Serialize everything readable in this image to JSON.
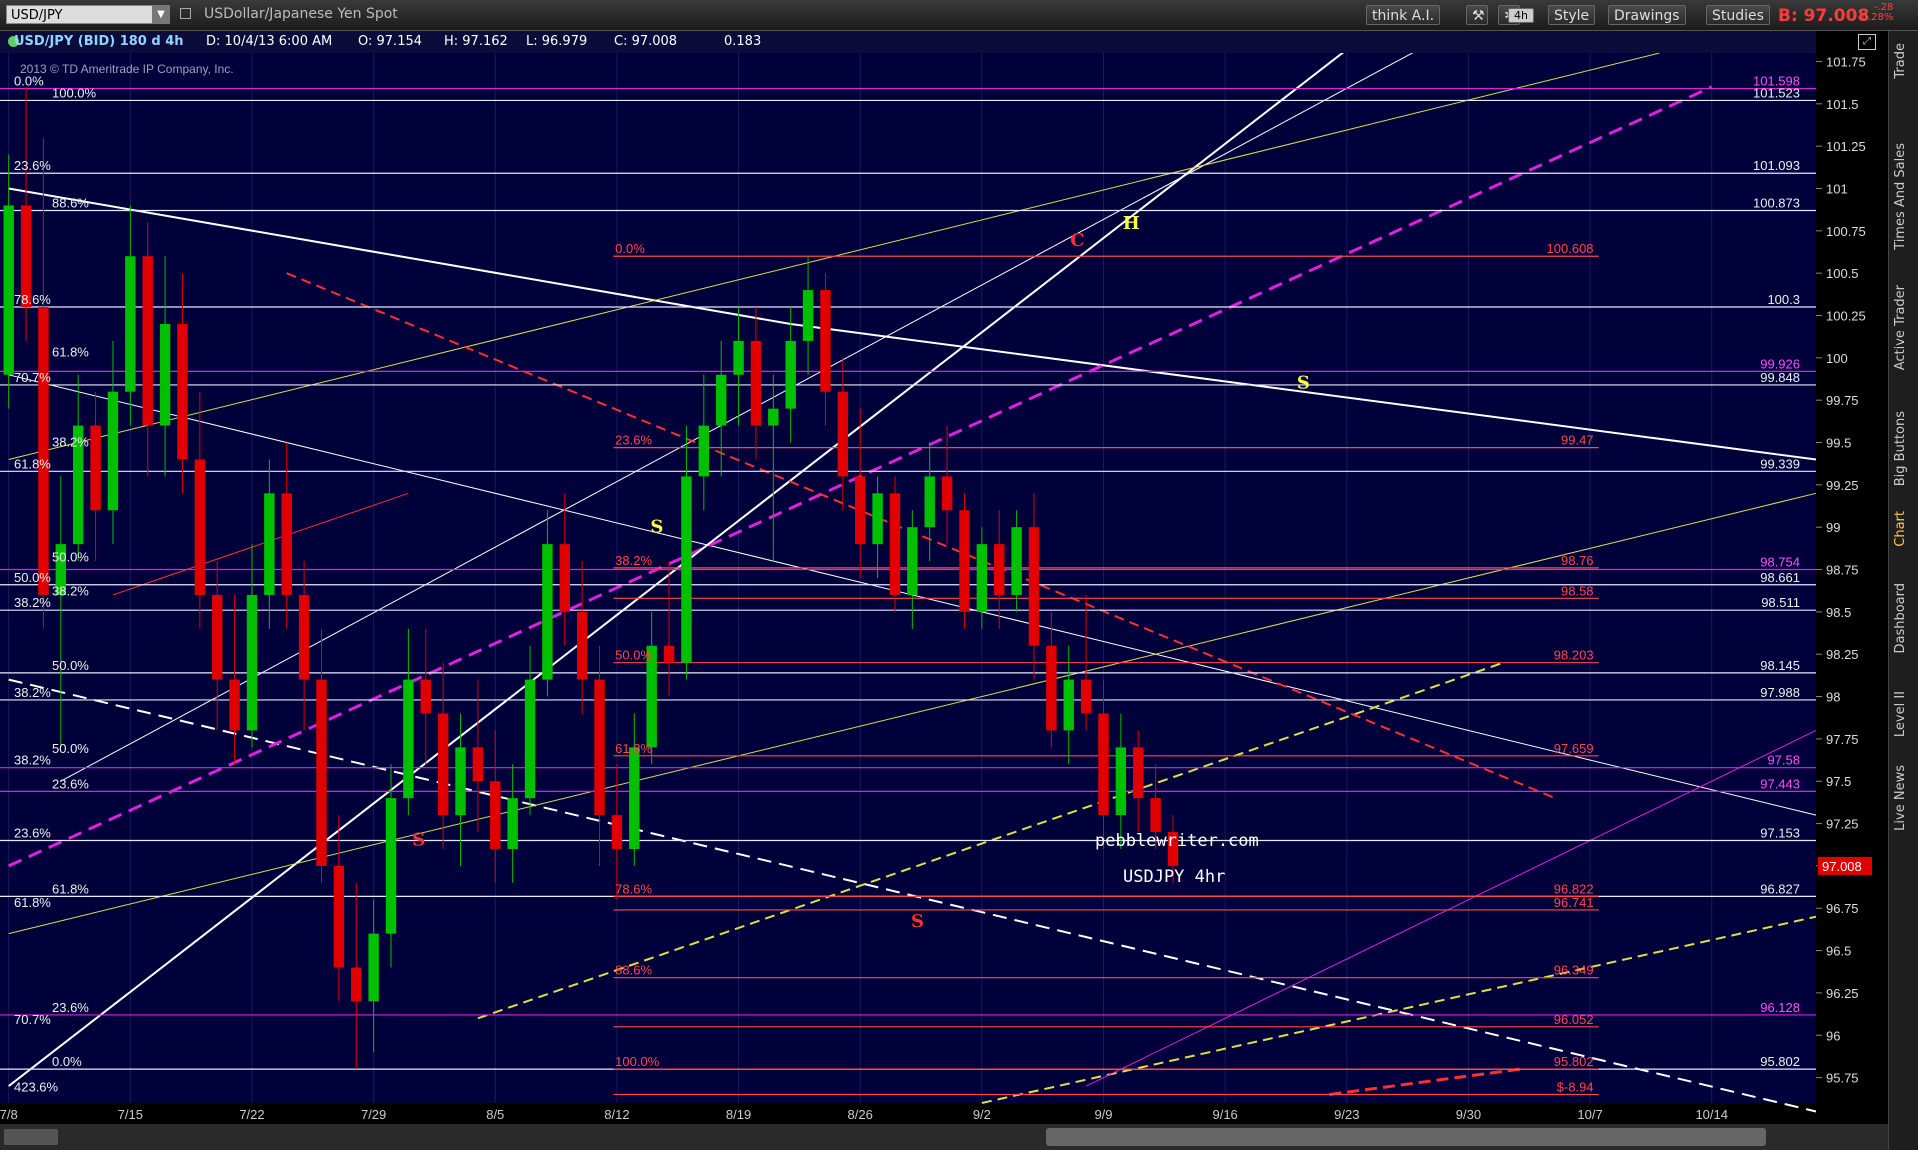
{
  "toolbar": {
    "symbol": "USD/JPY",
    "description": "USDollar/Japanese Yen Spot",
    "think_label": "think A.I.",
    "period_label": "4h",
    "style_label": "Style",
    "drawings_label": "Drawings",
    "studies_label": "Studies",
    "last_price": "B: 97.008",
    "change_1": "-.28",
    "change_2": "-0.28%"
  },
  "infobar": {
    "title": "USD/JPY (BID) 180 d 4h",
    "date": "D: 10/4/13 6:00 AM",
    "open": "O: 97.154",
    "high": "H: 97.162",
    "low": "L: 96.979",
    "close": "C: 97.008",
    "change": "0.183"
  },
  "side_tabs": [
    "Trade",
    "Times And Sales",
    "Active Trader",
    "Big Buttons",
    "Chart",
    "Dashboard",
    "Level II",
    "Live News"
  ],
  "copyright": "2013 © TD Ameritrade IP Company, Inc.",
  "watermark": "pebblewriter.com",
  "chart_title": "USDJPY 4hr",
  "colors": {
    "background": "#00003a",
    "up_candle": "#00c000",
    "down_candle": "#e00000",
    "white_line": "#ffffff",
    "magenta": "#e020e0",
    "yellow": "#e0e040",
    "red": "#ff3030",
    "pink": "#ff3070",
    "price_axis_text": "#dddddd"
  },
  "chart_data": {
    "type": "candlestick",
    "ylim": [
      95.6,
      101.8
    ],
    "y_ticks": [
      "101.75",
      "101.5",
      "101.25",
      "101",
      "100.75",
      "100.5",
      "100.25",
      "100",
      "99.75",
      "99.5",
      "99.25",
      "99",
      "98.75",
      "98.5",
      "98.25",
      "98",
      "97.75",
      "97.5",
      "97.25",
      "97",
      "96.75",
      "96.5",
      "96.25",
      "96",
      "95.75"
    ],
    "y_tick_values": [
      101.75,
      101.5,
      101.25,
      101,
      100.75,
      100.5,
      100.25,
      100,
      99.75,
      99.5,
      99.25,
      99,
      98.75,
      98.5,
      98.25,
      98,
      97.75,
      97.5,
      97.25,
      97,
      96.75,
      96.5,
      96.25,
      96,
      95.75
    ],
    "x_labels": [
      "7/8",
      "7/15",
      "7/22",
      "7/29",
      "8/5",
      "8/12",
      "8/19",
      "8/26",
      "9/2",
      "9/9",
      "9/16",
      "9/23",
      "9/30",
      "10/7",
      "10/14"
    ],
    "x_label_values": [
      0,
      7,
      14,
      21,
      28,
      35,
      42,
      49,
      56,
      63,
      70,
      77,
      84,
      91,
      98
    ],
    "x_range": [
      -0.5,
      104
    ],
    "current_price": "97.008",
    "candles": [
      [
        0,
        99.9,
        101.2,
        99.7,
        100.9
      ],
      [
        1,
        100.9,
        101.6,
        100.1,
        100.3
      ],
      [
        2,
        100.3,
        101.3,
        98.4,
        98.6
      ],
      [
        3,
        98.6,
        99.3,
        97.7,
        98.9
      ],
      [
        4,
        98.9,
        99.9,
        98.8,
        99.6
      ],
      [
        5,
        99.6,
        99.8,
        98.8,
        99.1
      ],
      [
        6,
        99.1,
        100.1,
        98.9,
        99.8
      ],
      [
        7,
        99.8,
        100.9,
        99.6,
        100.6
      ],
      [
        8,
        100.6,
        100.8,
        99.3,
        99.6
      ],
      [
        9,
        99.6,
        100.6,
        99.3,
        100.2
      ],
      [
        10,
        100.2,
        100.5,
        99.2,
        99.4
      ],
      [
        11,
        99.4,
        99.8,
        98.4,
        98.6
      ],
      [
        12,
        98.6,
        98.8,
        97.8,
        98.1
      ],
      [
        13,
        98.1,
        98.6,
        97.6,
        97.8
      ],
      [
        14,
        97.8,
        98.9,
        97.7,
        98.6
      ],
      [
        15,
        98.6,
        99.4,
        98.4,
        99.2
      ],
      [
        16,
        99.2,
        99.5,
        98.4,
        98.6
      ],
      [
        17,
        98.6,
        98.8,
        97.8,
        98.1
      ],
      [
        18,
        98.1,
        98.4,
        96.9,
        97.0
      ],
      [
        19,
        97.0,
        97.3,
        96.2,
        96.4
      ],
      [
        20,
        96.4,
        96.9,
        95.8,
        96.2
      ],
      [
        21,
        96.2,
        96.8,
        95.9,
        96.6
      ],
      [
        22,
        96.6,
        97.6,
        96.4,
        97.4
      ],
      [
        23,
        97.4,
        98.4,
        97.3,
        98.1
      ],
      [
        24,
        98.1,
        98.4,
        97.6,
        97.9
      ],
      [
        25,
        97.9,
        98.2,
        97.1,
        97.3
      ],
      [
        26,
        97.3,
        97.9,
        97.0,
        97.7
      ],
      [
        27,
        97.7,
        98.1,
        97.2,
        97.5
      ],
      [
        28,
        97.5,
        97.8,
        96.9,
        97.1
      ],
      [
        29,
        97.1,
        97.6,
        96.9,
        97.4
      ],
      [
        30,
        97.4,
        98.3,
        97.3,
        98.1
      ],
      [
        31,
        98.1,
        99.1,
        98.0,
        98.9
      ],
      [
        32,
        98.9,
        99.2,
        98.3,
        98.5
      ],
      [
        33,
        98.5,
        98.8,
        97.9,
        98.1
      ],
      [
        34,
        98.1,
        98.3,
        97.0,
        97.3
      ],
      [
        35,
        97.3,
        97.6,
        96.8,
        97.1
      ],
      [
        36,
        97.1,
        97.9,
        97.0,
        97.7
      ],
      [
        37,
        97.7,
        98.5,
        97.6,
        98.3
      ],
      [
        38,
        98.3,
        98.8,
        98.0,
        98.2
      ],
      [
        39,
        98.2,
        99.6,
        98.1,
        99.3
      ],
      [
        40,
        99.3,
        99.9,
        99.1,
        99.6
      ],
      [
        41,
        99.6,
        100.1,
        99.3,
        99.9
      ],
      [
        42,
        99.9,
        100.3,
        99.6,
        100.1
      ],
      [
        43,
        100.1,
        100.3,
        99.4,
        99.6
      ],
      [
        44,
        99.6,
        99.9,
        98.8,
        99.7
      ],
      [
        45,
        99.7,
        100.3,
        99.5,
        100.1
      ],
      [
        46,
        100.1,
        100.6,
        99.9,
        100.4
      ],
      [
        47,
        100.4,
        100.5,
        99.6,
        99.8
      ],
      [
        48,
        99.8,
        100.0,
        99.1,
        99.3
      ],
      [
        49,
        99.3,
        99.7,
        98.7,
        98.9
      ],
      [
        50,
        98.9,
        99.3,
        98.7,
        99.2
      ],
      [
        51,
        99.2,
        99.3,
        98.5,
        98.6
      ],
      [
        52,
        98.6,
        99.1,
        98.4,
        99.0
      ],
      [
        53,
        99.0,
        99.5,
        98.8,
        99.3
      ],
      [
        54,
        99.3,
        99.6,
        98.9,
        99.1
      ],
      [
        55,
        99.1,
        99.2,
        98.4,
        98.5
      ],
      [
        56,
        98.5,
        99.0,
        98.4,
        98.9
      ],
      [
        57,
        98.9,
        99.1,
        98.4,
        98.6
      ],
      [
        58,
        98.6,
        99.1,
        98.5,
        99.0
      ],
      [
        59,
        99.0,
        99.2,
        98.1,
        98.3
      ],
      [
        60,
        98.3,
        98.5,
        97.7,
        97.8
      ],
      [
        61,
        97.8,
        98.3,
        97.6,
        98.1
      ],
      [
        62,
        98.1,
        98.6,
        97.8,
        97.9
      ],
      [
        63,
        97.9,
        98.1,
        97.1,
        97.3
      ],
      [
        64,
        97.3,
        97.9,
        97.1,
        97.7
      ],
      [
        65,
        97.7,
        97.8,
        97.2,
        97.4
      ],
      [
        66,
        97.4,
        97.6,
        97.1,
        97.2
      ],
      [
        67,
        97.2,
        97.3,
        96.9,
        97.0
      ]
    ],
    "levels_white": [
      {
        "label": "101.523",
        "value": 101.52
      },
      {
        "label": "101.093",
        "value": 101.09
      },
      {
        "label": "100.873",
        "value": 100.87
      },
      {
        "label": "100.3",
        "value": 100.3
      },
      {
        "label": "99.848",
        "value": 99.84
      },
      {
        "label": "99.339",
        "value": 99.33
      },
      {
        "label": "98.661",
        "value": 98.66
      },
      {
        "label": "98.511",
        "value": 98.51
      },
      {
        "label": "98.145",
        "value": 98.14
      },
      {
        "label": "97.988",
        "value": 97.98
      },
      {
        "label": "97.153",
        "value": 97.15
      },
      {
        "label": "96.827",
        "value": 96.82
      },
      {
        "label": "95.802",
        "value": 95.8
      }
    ],
    "levels_magenta": [
      {
        "label": "101.598",
        "value": 101.59
      },
      {
        "label": "99.926",
        "value": 99.92
      },
      {
        "label": "98.754",
        "value": 98.75
      },
      {
        "label": "97.58",
        "value": 97.58
      },
      {
        "label": "97.443",
        "value": 97.44
      },
      {
        "label": "96.128",
        "value": 96.12
      }
    ],
    "levels_red": [
      {
        "label": "100.608",
        "value": 100.6
      },
      {
        "label": "99.47",
        "value": 99.47
      },
      {
        "label": "98.76",
        "value": 98.76
      },
      {
        "label": "98.58",
        "value": 98.58
      },
      {
        "label": "98.203",
        "value": 98.2
      },
      {
        "label": "97.659",
        "value": 97.65
      },
      {
        "label": "96.822",
        "value": 96.82
      },
      {
        "label": "96.741",
        "value": 96.74
      },
      {
        "label": "96.349",
        "value": 96.34
      },
      {
        "label": "96.052",
        "value": 96.05
      },
      {
        "label": "95.802",
        "value": 95.8
      },
      {
        "label": "$-8.94",
        "value": 95.65
      }
    ],
    "fib_left_labels": [
      {
        "label": "0.0%",
        "value": 101.59
      },
      {
        "label": "100.0%",
        "value": 101.52
      },
      {
        "label": "23.6%",
        "value": 101.09
      },
      {
        "label": "88.6%",
        "value": 100.87
      },
      {
        "label": "78.6%",
        "value": 100.3
      },
      {
        "label": "61.8%",
        "value": 99.99
      },
      {
        "label": "70.7%",
        "value": 99.84
      },
      {
        "label": "38.2%",
        "value": 99.46
      },
      {
        "label": "61.8%",
        "value": 99.33
      },
      {
        "label": "50.0%",
        "value": 98.78
      },
      {
        "label": "50.0%",
        "value": 98.66
      },
      {
        "label": "38.2%",
        "value": 98.58
      },
      {
        "label": "38.2%",
        "value": 98.51
      },
      {
        "label": "50.0%",
        "value": 98.14
      },
      {
        "label": "38.2%",
        "value": 97.98
      },
      {
        "label": "50.0%",
        "value": 97.65
      },
      {
        "label": "38.2%",
        "value": 97.58
      },
      {
        "label": "23.6%",
        "value": 97.44
      },
      {
        "label": "23.6%",
        "value": 97.15
      },
      {
        "label": "61.8%",
        "value": 96.82
      },
      {
        "label": "61.8%",
        "value": 96.74
      },
      {
        "label": "23.6%",
        "value": 96.12
      },
      {
        "label": "70.7%",
        "value": 96.05
      },
      {
        "label": "0.0%",
        "value": 95.8
      },
      {
        "label": "423.6%",
        "value": 95.65
      }
    ],
    "fib_mid_labels": [
      {
        "label": "0.0%",
        "value": 100.6
      },
      {
        "label": "23.6%",
        "value": 99.47
      },
      {
        "label": "38.2%",
        "value": 98.76
      },
      {
        "label": "50.0%",
        "value": 98.2
      },
      {
        "label": "61.8%",
        "value": 97.65
      },
      {
        "label": "78.6%",
        "value": 96.82
      },
      {
        "label": "88.6%",
        "value": 96.34
      },
      {
        "label": "100.0%",
        "value": 95.8
      }
    ],
    "annotations": [
      {
        "text": "H",
        "x": 64.6,
        "y": 100.76,
        "color": "#ffff40"
      },
      {
        "text": "C",
        "x": 61.5,
        "y": 100.66,
        "color": "#ff3030"
      },
      {
        "text": "S",
        "x": 74.5,
        "y": 99.82,
        "color": "#ffff40"
      },
      {
        "text": "S",
        "x": 37.3,
        "y": 98.97,
        "color": "#ffff40"
      },
      {
        "text": "S",
        "x": 23.6,
        "y": 97.12,
        "color": "#ff3030"
      },
      {
        "text": "S",
        "x": 52.3,
        "y": 96.64,
        "color": "#ff3030"
      }
    ]
  }
}
